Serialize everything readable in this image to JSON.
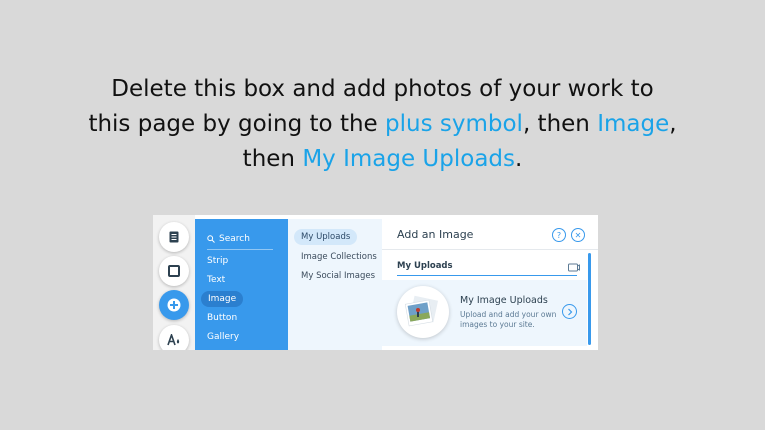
{
  "instructions": {
    "line1": "Delete this box and add photos of your work to",
    "line2_pre": "this page by going to the ",
    "line2_hl1": "plus symbol",
    "line2_mid": ", then ",
    "line2_hl2": "Image",
    "line2_post": ",",
    "line3_pre": "then ",
    "line3_hl": "My Image Uploads",
    "line3_post": "."
  },
  "colors": {
    "accent": "#1aa3e8",
    "panel_blue": "#3899ec"
  },
  "rail": {
    "icons": [
      "pages-icon",
      "background-icon",
      "add-icon",
      "theme-icon"
    ]
  },
  "categories": {
    "search_label": "Search",
    "items": [
      "Strip",
      "Text",
      "Image",
      "Button",
      "Gallery"
    ],
    "selected": "Image"
  },
  "submenu": {
    "items": [
      "My Uploads",
      "Image Collections",
      "My Social Images"
    ],
    "selected": "My Uploads"
  },
  "panel": {
    "title": "Add an Image",
    "help": "?",
    "close": "✕",
    "section": "My Uploads",
    "card_title": "My Image Uploads",
    "card_desc": "Upload and add your own images to your site."
  }
}
